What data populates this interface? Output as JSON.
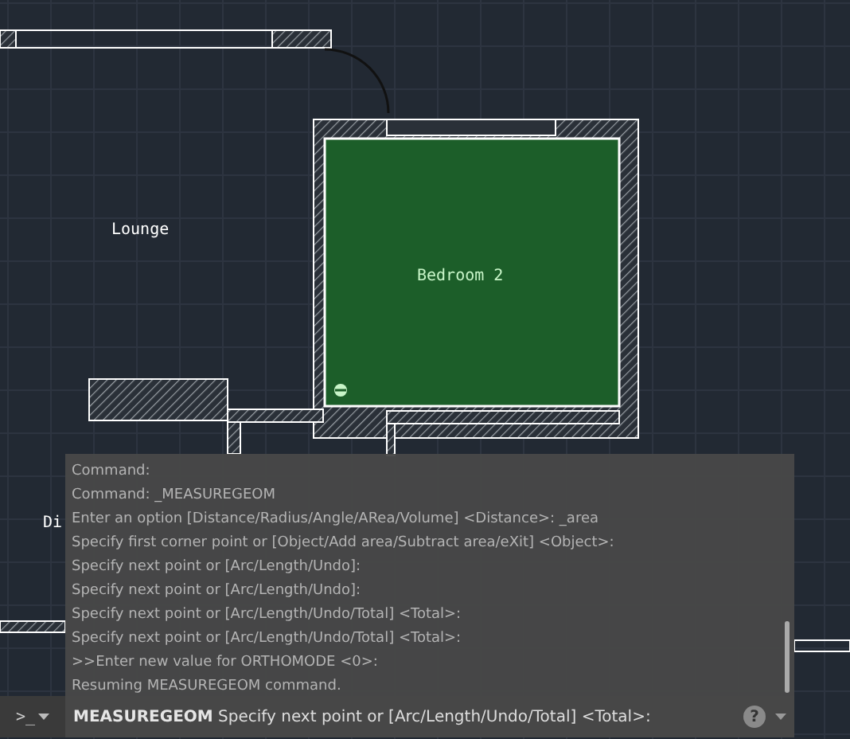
{
  "drawing": {
    "rooms": [
      {
        "label": "Lounge"
      },
      {
        "label": "Bedroom 2"
      },
      {
        "label": "Di"
      }
    ]
  },
  "command_line": {
    "history": [
      "Command:",
      "Command: _MEASUREGEOM",
      "Enter an option [Distance/Radius/Angle/ARea/Volume] <Distance>: _area",
      "Specify first corner point or [Object/Add area/Subtract area/eXit] <Object>:",
      "Specify next point or [Arc/Length/Undo]:",
      "Specify next point or [Arc/Length/Undo]:",
      "Specify next point or [Arc/Length/Undo/Total] <Total>:",
      "Specify next point or [Arc/Length/Undo/Total] <Total>:",
      ">>Enter new value for ORTHOMODE <0>:",
      "Resuming MEASUREGEOM command."
    ],
    "prompt_symbol": ">_",
    "command": "MEASUREGEOM",
    "prompt": "Specify next point or [Arc/Length/Undo/Total] <Total>:",
    "help": "?"
  }
}
